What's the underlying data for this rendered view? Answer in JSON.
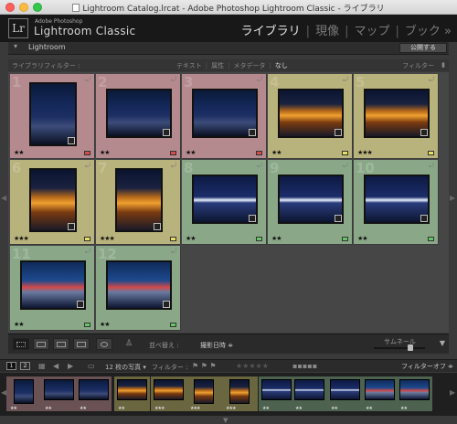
{
  "window": {
    "title": "Lightroom Catalog.lrcat - Adobe Photoshop Lightroom Classic - ライブラリ"
  },
  "identity": {
    "logo": "Lr",
    "brand_small": "Adobe Photoshop",
    "brand_big": "Lightroom Classic",
    "modules": [
      "ライブラリ",
      "現像",
      "マップ",
      "ブック"
    ],
    "more": "»"
  },
  "panel": {
    "label": "Lightroom",
    "publish_button": "公開する"
  },
  "filter_bar": {
    "left_label": "ライブラリフィルター :",
    "tabs": [
      "テキスト",
      "属性",
      "メタデータ",
      "なし"
    ],
    "active_tab": "なし",
    "right_label": "フィルター"
  },
  "grid": {
    "cells": [
      {
        "num": "1",
        "stars": "★★",
        "label_color": "#d94a4a",
        "bg": "#b58a8e",
        "img": "night-city"
      },
      {
        "num": "2",
        "stars": "★★",
        "label_color": "#d94a4a",
        "bg": "#b58a8e",
        "img": "night-city"
      },
      {
        "num": "3",
        "stars": "★★",
        "label_color": "#d94a4a",
        "bg": "#b58a8e",
        "img": "night-city"
      },
      {
        "num": "4",
        "stars": "★★",
        "label_color": "#e8e060",
        "bg": "#b8b27c",
        "img": "gold-station"
      },
      {
        "num": "5",
        "stars": "★★★",
        "label_color": "#e8e060",
        "bg": "#b8b27c",
        "img": "gold-station"
      },
      {
        "num": "6",
        "stars": "★★★",
        "label_color": "#e8e060",
        "bg": "#b8b27c",
        "img": "gold-station"
      },
      {
        "num": "7",
        "stars": "★★★",
        "label_color": "#e8e060",
        "bg": "#b8b27c",
        "img": "gold-station"
      },
      {
        "num": "8",
        "stars": "★★",
        "label_color": "#66c766",
        "bg": "#8aa888",
        "img": "bridge"
      },
      {
        "num": "9",
        "stars": "★★",
        "label_color": "#66c766",
        "bg": "#8aa888",
        "img": "bridge"
      },
      {
        "num": "10",
        "stars": "★★",
        "label_color": "#66c766",
        "bg": "#8aa888",
        "img": "bridge"
      },
      {
        "num": "11",
        "stars": "★★",
        "label_color": "#66c766",
        "bg": "#8aa888",
        "img": "waterfront"
      },
      {
        "num": "12",
        "stars": "★★",
        "label_color": "#66c766",
        "bg": "#8aa888",
        "img": "waterfront"
      }
    ]
  },
  "toolbar": {
    "sort_label": "並べ替え :",
    "sort_value": "撮影日時 ≑",
    "thumb_label": "サムネール",
    "thumb_size": 0.55,
    "menu_icon": "▼"
  },
  "filmstrip_bar": {
    "screen1": "1",
    "screen2": "2",
    "count_text": "12 枚の写真 ▾",
    "filter_label": "フィルター :",
    "filter_off": "フィルターオフ ≑"
  },
  "filmstrip": {
    "thumbs": [
      {
        "stars": "★★",
        "img": "night-city"
      },
      {
        "stars": "★★",
        "img": "night-city"
      },
      {
        "stars": "★★",
        "img": "night-city"
      },
      {
        "stars": "★★",
        "img": "gold-station"
      },
      {
        "stars": "★★★",
        "img": "gold-station"
      },
      {
        "stars": "★★★",
        "img": "gold-station"
      },
      {
        "stars": "★★★",
        "img": "gold-station"
      },
      {
        "stars": "★★",
        "img": "bridge"
      },
      {
        "stars": "★★",
        "img": "bridge"
      },
      {
        "stars": "★★",
        "img": "bridge"
      },
      {
        "stars": "★★",
        "img": "waterfront"
      },
      {
        "stars": "★★",
        "img": "waterfront"
      }
    ]
  }
}
